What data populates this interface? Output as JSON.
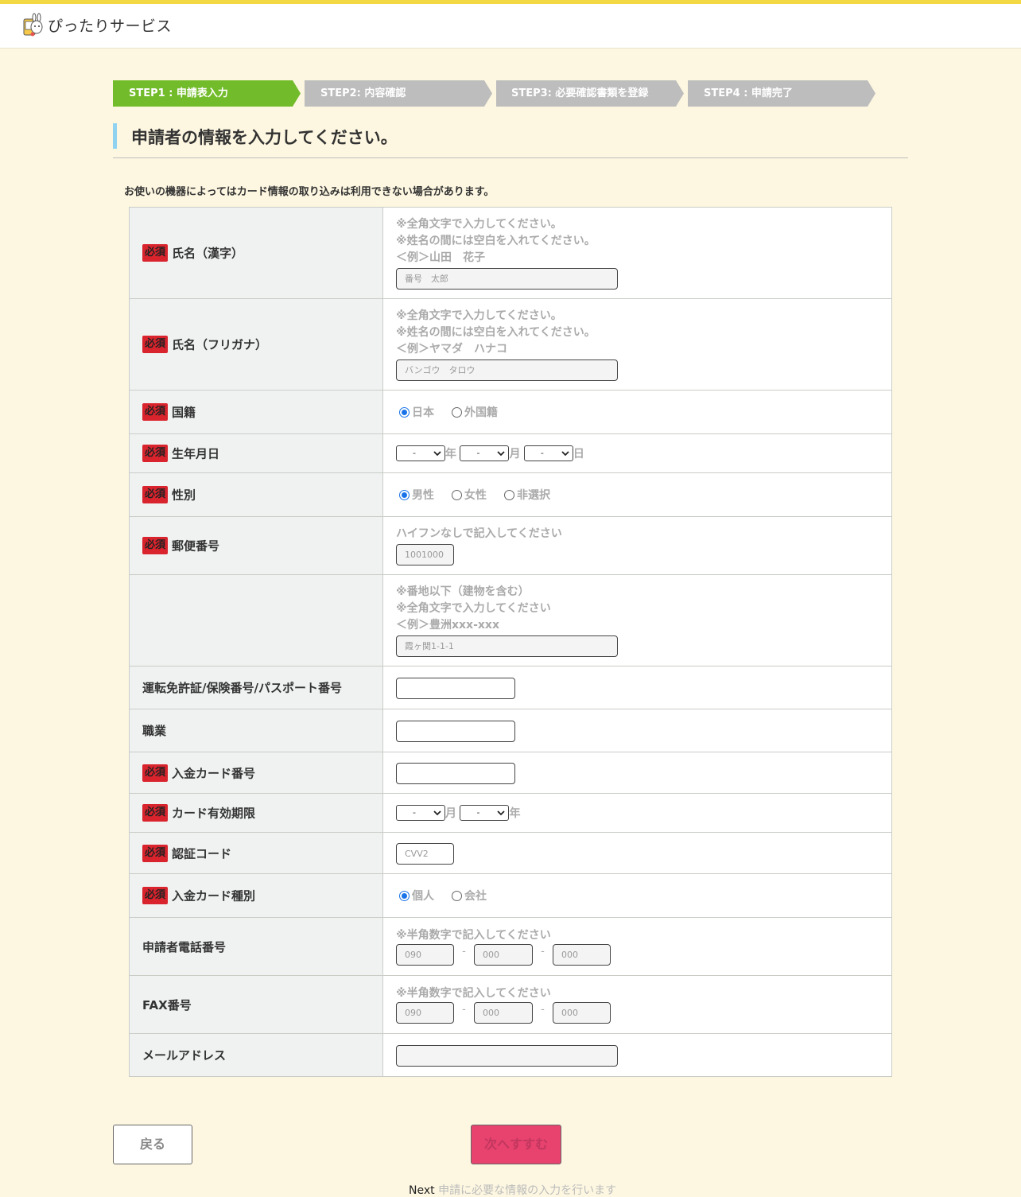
{
  "app": {
    "title": "ぴったりサービス"
  },
  "steps": [
    {
      "label": "STEP1 : 申請表入力",
      "color": "#72bb2a",
      "active": true
    },
    {
      "label": "STEP2: 内容確認",
      "color": "#bdbdbd",
      "active": false
    },
    {
      "label": "STEP3:  必要確認書類を登録",
      "color": "#bdbdbd",
      "active": false
    },
    {
      "label": "STEP4 : 申請完了",
      "color": "#bdbdbd",
      "active": false
    }
  ],
  "heading": "申請者の情報を入力してください。",
  "notice": "お使いの機器によってはカード情報の取り込みは利用できない場合があります。",
  "required_badge": "必須",
  "fields": {
    "name_kanji": {
      "label": "氏名（漢字）",
      "hints": [
        "※全角文字で入力してください。",
        "※姓名の間には空白を入れてください。",
        "＜例＞山田　花子"
      ],
      "placeholder": "番号　太郎"
    },
    "name_kana": {
      "label": "氏名（フリガナ）",
      "hints": [
        "※全角文字で入力してください。",
        "※姓名の間には空白を入れてください。",
        "＜例＞ヤマダ　ハナコ"
      ],
      "placeholder": "バンゴウ　タロウ"
    },
    "nationality": {
      "label": "国籍",
      "options": [
        "日本",
        "外国籍"
      ],
      "selected": "日本"
    },
    "birthdate": {
      "label": "生年月日",
      "year_value": "-",
      "month_value": "-",
      "day_value": "-",
      "unit_year": "年",
      "unit_month": "月",
      "unit_day": "日"
    },
    "gender": {
      "label": "性別",
      "options": [
        "男性",
        "女性",
        "非選択"
      ],
      "selected": "男性"
    },
    "postal": {
      "label": "郵便番号",
      "hint": "ハイフンなしで記入してください",
      "placeholder": "1001000"
    },
    "address": {
      "label": "",
      "hints": [
        "※番地以下（建物を含む）",
        "※全角文字で入力してください",
        "＜例＞豊洲xxx-xxx"
      ],
      "placeholder": "霞ヶ関1-1-1"
    },
    "license": {
      "label": "運転免許証/保険番号/パスポート番号",
      "value": ""
    },
    "occupation": {
      "label": "職業",
      "value": ""
    },
    "card_number": {
      "label": "入金カード番号",
      "value": ""
    },
    "card_expiry": {
      "label": "カード有効期限",
      "month_value": "-",
      "year_value": "-",
      "unit_month": "月",
      "unit_year": "年"
    },
    "cvv": {
      "label": "認証コード",
      "placeholder": "CVV2"
    },
    "card_type": {
      "label": "入金カード種別",
      "options": [
        "個人",
        "会社"
      ],
      "selected": "個人"
    },
    "phone": {
      "label": "申請者電話番号",
      "hint": "※半角数字で記入してください",
      "placeholders": [
        "090",
        "000",
        "000"
      ],
      "separator": "-"
    },
    "fax": {
      "label": "FAX番号",
      "hint": "※半角数字で記入してください",
      "placeholders": [
        "090",
        "000",
        "000"
      ],
      "separator": "-"
    },
    "email": {
      "label": "メールアドレス",
      "value": ""
    }
  },
  "buttons": {
    "back": "戻る",
    "next": "次へすすむ"
  },
  "footnote": {
    "key": "Next",
    "text": "申請に必要な情報の入力を行います"
  }
}
